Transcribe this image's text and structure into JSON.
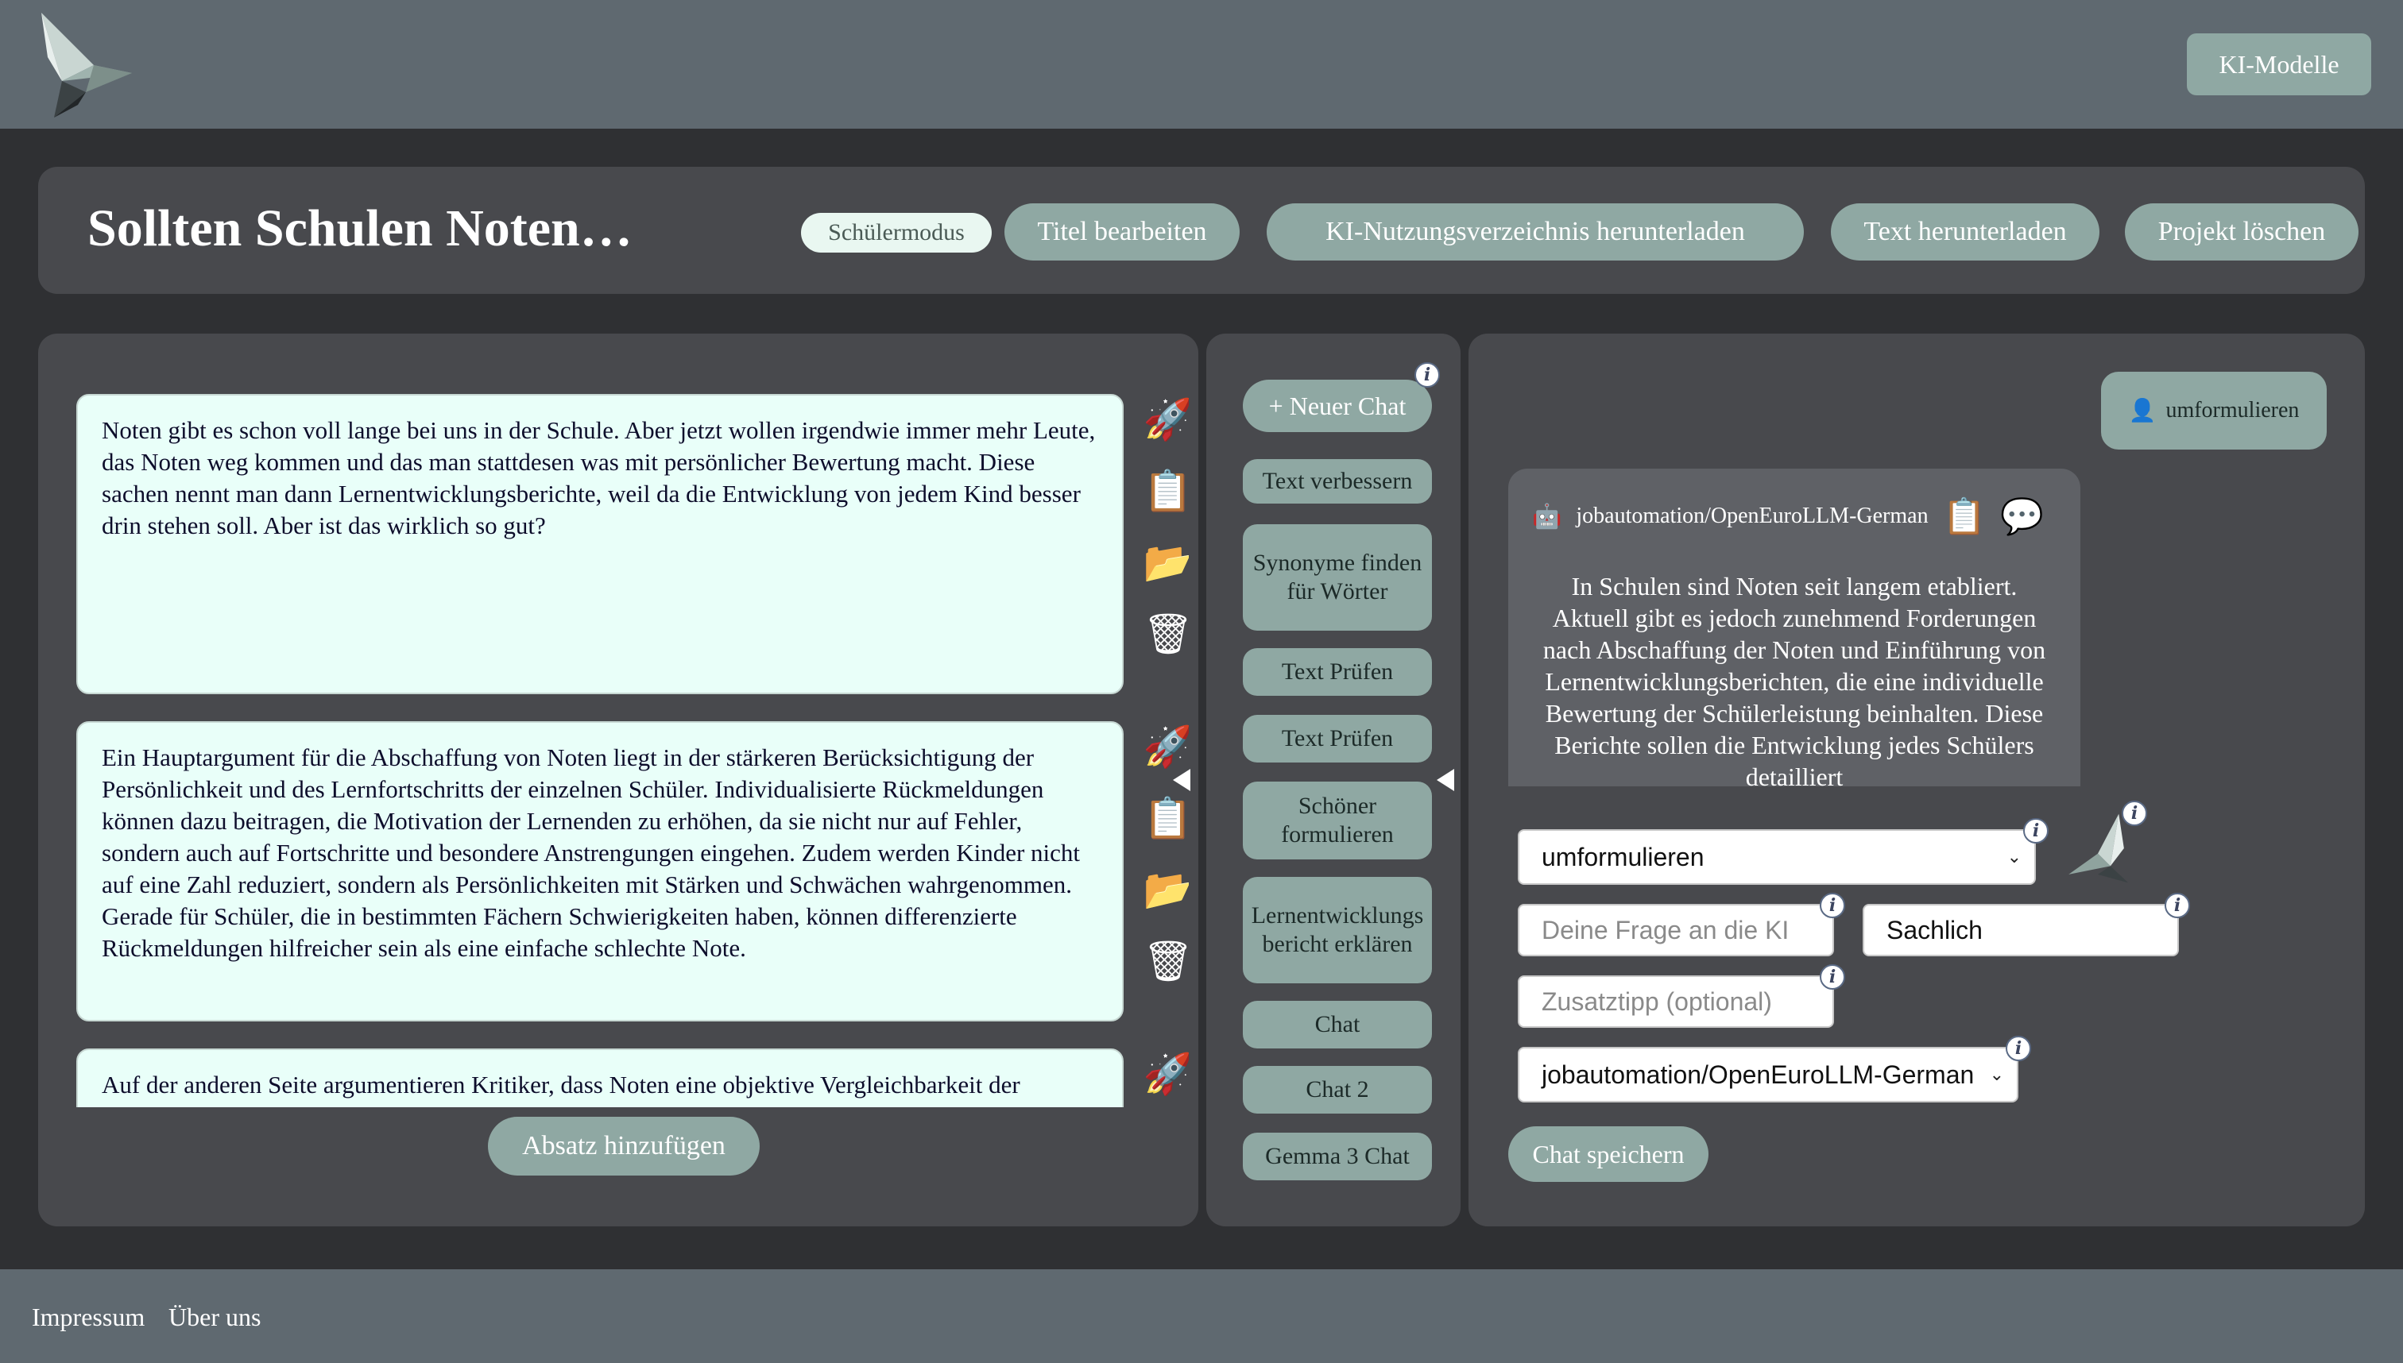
{
  "nav": {
    "models_button": "KI-Modelle"
  },
  "header": {
    "title": "Sollten Schulen Noten…",
    "mode_toggle": "Schülermodus",
    "buttons": [
      "Titel bearbeiten",
      "KI-Nutzungsverzeichnis herunterladen",
      "Text herunterladen",
      "Projekt löschen"
    ]
  },
  "paragraphs": [
    "Noten gibt es schon voll lange bei uns in der Schule. Aber jetzt wollen irgendwie immer mehr Leute, das Noten weg kommen und das man stattdesen was mit persönlicher Bewertung macht. Diese sachen nennt man dann Lernentwicklungsberichte, weil da die Entwicklung von jedem Kind besser drin stehen soll. Aber ist das wirklich so gut?",
    "Ein Hauptargument für die Abschaffung von Noten liegt in der stärkeren Berücksichtigung der Persönlichkeit und des Lernfortschritts der einzelnen Schüler. Individualisierte Rückmeldungen können dazu beitragen, die Motivation der Lernenden zu erhöhen, da sie nicht nur auf Fehler, sondern auch auf Fortschritte und besondere Anstrengungen eingehen. Zudem werden Kinder nicht auf eine Zahl reduziert, sondern als Persönlichkeiten mit Stärken und Schwächen wahrgenommen. Gerade für Schüler, die in bestimmten Fächern Schwierigkeiten haben, können differenzierte Rückmeldungen hilfreicher sein als eine einfache schlechte Note.",
    "Auf der anderen Seite argumentieren Kritiker, dass Noten eine objektive Vergleichbarkeit der Leistungen ermöglichen – nicht nur innerhalb einer Klasse"
  ],
  "add_paragraph": "Absatz hinzufügen",
  "tools": {
    "generate_icon": "rocket-icon",
    "copy_icon": "clipboard-icon",
    "folder_icon": "folder-icon",
    "delete_icon": "trash-icon"
  },
  "middle": {
    "new_chat": "+ Neuer Chat",
    "prompts": [
      "Text verbessern",
      "Synonyme finden für Wörter",
      "Text Prüfen",
      "Text Prüfen",
      "Schöner formulieren",
      "Lernentwicklungsbericht erklären",
      "Chat",
      "Chat 2",
      "Gemma 3 Chat"
    ]
  },
  "chat": {
    "user_message": "umformulieren",
    "bot_model": "jobautomation/OpenEuroLLM-German",
    "bot_text": "In Schulen sind Noten seit langem etabliert. Aktuell gibt es jedoch zunehmend Forderungen nach Abschaffung der Noten und Einführung von Lernentwicklungsberichten, die eine individuelle Bewertung der Schülerleistung beinhalten. Diese Berichte sollen die Entwicklung jedes Schülers detailliert",
    "action_select": "umformulieren",
    "question_placeholder": "Deine Frage an die KI",
    "tone_value": "Sachlich",
    "hint_placeholder": "Zusatztipp (optional)",
    "model_select": "jobautomation/OpenEuroLLM-German",
    "save_button": "Chat speichern"
  },
  "footer": {
    "links": [
      "Impressum",
      "Über uns"
    ]
  },
  "colors": {
    "accent": "#8fa8a3",
    "panel": "#48494d",
    "bar": "#5f6970",
    "paragraph_bg": "#e9fff9"
  }
}
